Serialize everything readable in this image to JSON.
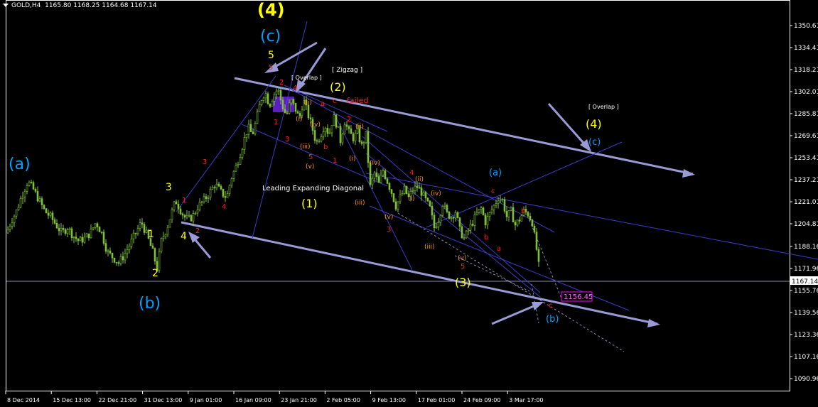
{
  "header": {
    "symbol": "GOLD,H4",
    "open": "1165.80",
    "high": "1168.25",
    "low": "1164.68",
    "close": "1167.14"
  },
  "colors": {
    "background": "#000000",
    "candle": "#7fbf3f",
    "axis": "#ffffff",
    "trendline_heavy": "#9a9ad6",
    "trendline_thin": "#3c3cc8",
    "label_yellow": "#ffff00",
    "label_cyan": "#00a0ff",
    "label_red": "#ff2020",
    "label_orange": "#ff9900",
    "label_white": "#ffffff",
    "current_price_box": "#ff00ff"
  },
  "chart_data": {
    "type": "candlestick",
    "title": "",
    "ylim": [
      1082.6,
      1358.4
    ],
    "y_ticks": [
      1350.61,
      1334.41,
      1318.21,
      1302.01,
      1285.81,
      1269.61,
      1253.41,
      1237.21,
      1221.01,
      1204.81,
      1188.16,
      1171.96,
      1155.76,
      1139.56,
      1123.36,
      1107.16,
      1090.96
    ],
    "x_ticks": [
      "8 Dec 2014",
      "15 Dec 13:00",
      "22 Dec 21:00",
      "31 Dec 13:00",
      "9 Jan 01:00",
      "16 Jan 09:00",
      "23 Jan 21:00",
      "2 Feb 05:00",
      "9 Feb 13:00",
      "17 Feb 01:00",
      "24 Feb 09:00",
      "3 Mar 17:00"
    ],
    "current_price": "1167.14",
    "target_price": "1156.45",
    "price_path": [
      [
        0,
        1198
      ],
      [
        6,
        1206
      ],
      [
        14,
        1214
      ],
      [
        22,
        1226
      ],
      [
        30,
        1236
      ],
      [
        38,
        1230
      ],
      [
        46,
        1222
      ],
      [
        54,
        1214
      ],
      [
        62,
        1210
      ],
      [
        70,
        1204
      ],
      [
        78,
        1198
      ],
      [
        86,
        1202
      ],
      [
        94,
        1196
      ],
      [
        102,
        1192
      ],
      [
        110,
        1194
      ],
      [
        118,
        1198
      ],
      [
        126,
        1206
      ],
      [
        134,
        1198
      ],
      [
        142,
        1184
      ],
      [
        150,
        1180
      ],
      [
        158,
        1176
      ],
      [
        166,
        1182
      ],
      [
        174,
        1190
      ],
      [
        182,
        1198
      ],
      [
        190,
        1206
      ],
      [
        198,
        1196
      ],
      [
        206,
        1184
      ],
      [
        212,
        1172
      ],
      [
        218,
        1192
      ],
      [
        226,
        1202
      ],
      [
        232,
        1212
      ],
      [
        238,
        1222
      ],
      [
        244,
        1216
      ],
      [
        250,
        1210
      ],
      [
        256,
        1208
      ],
      [
        262,
        1210
      ],
      [
        270,
        1218
      ],
      [
        278,
        1222
      ],
      [
        286,
        1228
      ],
      [
        294,
        1234
      ],
      [
        302,
        1228
      ],
      [
        310,
        1224
      ],
      [
        316,
        1238
      ],
      [
        324,
        1248
      ],
      [
        332,
        1262
      ],
      [
        340,
        1276
      ],
      [
        346,
        1270
      ],
      [
        352,
        1282
      ],
      [
        358,
        1296
      ],
      [
        364,
        1302
      ],
      [
        370,
        1292
      ],
      [
        376,
        1300
      ],
      [
        382,
        1304
      ],
      [
        388,
        1292
      ],
      [
        394,
        1284
      ],
      [
        400,
        1296
      ],
      [
        406,
        1290
      ],
      [
        412,
        1282
      ],
      [
        418,
        1296
      ],
      [
        424,
        1286
      ],
      [
        430,
        1276
      ],
      [
        436,
        1264
      ],
      [
        442,
        1270
      ],
      [
        448,
        1278
      ],
      [
        454,
        1270
      ],
      [
        460,
        1284
      ],
      [
        466,
        1276
      ],
      [
        470,
        1266
      ],
      [
        476,
        1280
      ],
      [
        482,
        1272
      ],
      [
        488,
        1268
      ],
      [
        494,
        1272
      ],
      [
        500,
        1262
      ],
      [
        506,
        1270
      ],
      [
        512,
        1232
      ],
      [
        518,
        1242
      ],
      [
        524,
        1234
      ],
      [
        530,
        1244
      ],
      [
        536,
        1236
      ],
      [
        542,
        1228
      ],
      [
        548,
        1218
      ],
      [
        554,
        1224
      ],
      [
        560,
        1230
      ],
      [
        566,
        1224
      ],
      [
        572,
        1230
      ],
      [
        578,
        1232
      ],
      [
        584,
        1228
      ],
      [
        590,
        1222
      ],
      [
        596,
        1216
      ],
      [
        602,
        1202
      ],
      [
        608,
        1208
      ],
      [
        614,
        1220
      ],
      [
        620,
        1212
      ],
      [
        626,
        1210
      ],
      [
        632,
        1214
      ],
      [
        638,
        1200
      ],
      [
        644,
        1194
      ],
      [
        650,
        1200
      ],
      [
        656,
        1206
      ],
      [
        662,
        1212
      ],
      [
        668,
        1216
      ],
      [
        674,
        1206
      ],
      [
        680,
        1212
      ],
      [
        686,
        1218
      ],
      [
        692,
        1224
      ],
      [
        698,
        1222
      ],
      [
        704,
        1210
      ],
      [
        710,
        1214
      ],
      [
        716,
        1204
      ],
      [
        722,
        1208
      ],
      [
        728,
        1214
      ],
      [
        734,
        1212
      ],
      [
        740,
        1206
      ],
      [
        746,
        1186
      ],
      [
        751,
        1166
      ]
    ],
    "annotations": {
      "yellow": [
        "(4)",
        "(2)",
        "(1)",
        "(3)",
        "(4)"
      ],
      "cyan": [
        "(c)",
        "(a)",
        "(b)",
        "(a)",
        "(c)",
        "(b)"
      ],
      "text": [
        "[ Zigzag ]",
        "[ Overlap ]",
        "[ Overlap ]",
        "failed",
        "Leading Expanding Diagonal"
      ]
    }
  }
}
